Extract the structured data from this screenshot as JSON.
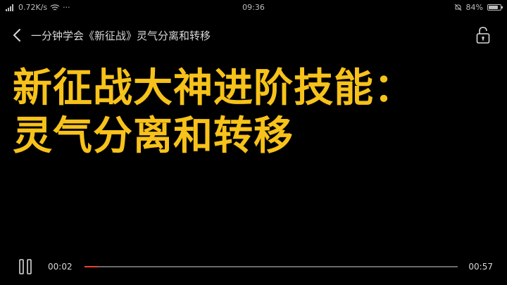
{
  "status_bar": {
    "network_speed": "0.72K/s",
    "more": "···",
    "time": "09:36",
    "battery_percent": "84%",
    "battery_level": 0.84
  },
  "top_bar": {
    "title": "一分钟学会《新征战》灵气分离和转移",
    "back_icon": "chevron-left-icon",
    "lock_icon": "lock-icon"
  },
  "headline": {
    "line1": "新征战大神进阶技能：",
    "line2": "灵气分离和转移"
  },
  "player": {
    "current_time": "00:02",
    "total_time": "00:57",
    "progress": 0.035,
    "progress_color": "#e8452c",
    "headline_color": "#f7c21a"
  }
}
